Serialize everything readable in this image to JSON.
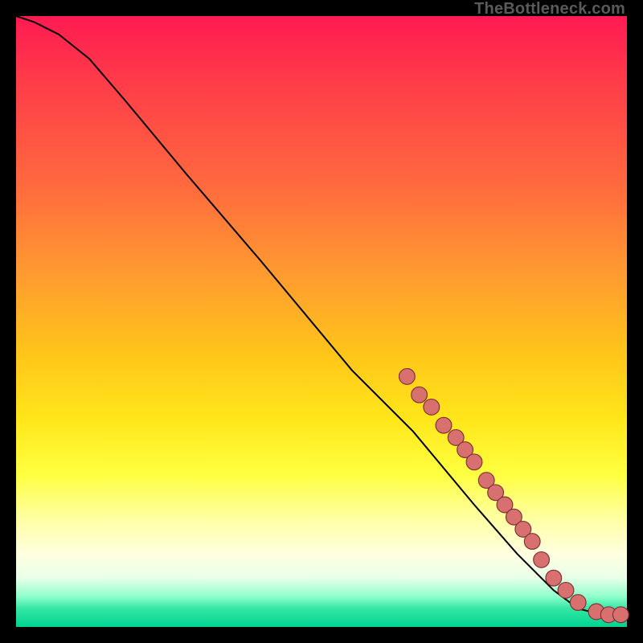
{
  "watermark": "TheBottleneck.com",
  "chart_data": {
    "type": "line",
    "title": "",
    "xlabel": "",
    "ylabel": "",
    "xlim": [
      0,
      100
    ],
    "ylim": [
      0,
      100
    ],
    "curve": [
      {
        "x": 0,
        "y": 100
      },
      {
        "x": 3,
        "y": 99
      },
      {
        "x": 7,
        "y": 97
      },
      {
        "x": 12,
        "y": 93
      },
      {
        "x": 18,
        "y": 86
      },
      {
        "x": 28,
        "y": 74
      },
      {
        "x": 40,
        "y": 60
      },
      {
        "x": 55,
        "y": 42
      },
      {
        "x": 65,
        "y": 32
      },
      {
        "x": 75,
        "y": 20
      },
      {
        "x": 82,
        "y": 12
      },
      {
        "x": 88,
        "y": 6
      },
      {
        "x": 92,
        "y": 3
      },
      {
        "x": 96,
        "y": 2
      },
      {
        "x": 100,
        "y": 2
      }
    ],
    "highlight_points": [
      {
        "x": 64,
        "y": 41
      },
      {
        "x": 66,
        "y": 38
      },
      {
        "x": 68,
        "y": 36
      },
      {
        "x": 70,
        "y": 33
      },
      {
        "x": 72,
        "y": 31
      },
      {
        "x": 73.5,
        "y": 29
      },
      {
        "x": 75,
        "y": 27
      },
      {
        "x": 77,
        "y": 24
      },
      {
        "x": 78.5,
        "y": 22
      },
      {
        "x": 80,
        "y": 20
      },
      {
        "x": 81.5,
        "y": 18
      },
      {
        "x": 83,
        "y": 16
      },
      {
        "x": 84.5,
        "y": 14
      },
      {
        "x": 86,
        "y": 11
      },
      {
        "x": 88,
        "y": 8
      },
      {
        "x": 90,
        "y": 6
      },
      {
        "x": 92,
        "y": 4
      },
      {
        "x": 95,
        "y": 2.5
      },
      {
        "x": 97,
        "y": 2
      },
      {
        "x": 99,
        "y": 2
      }
    ],
    "colors": {
      "line": "#000000",
      "point_fill": "#d97070",
      "point_stroke": "#7a3030"
    }
  }
}
